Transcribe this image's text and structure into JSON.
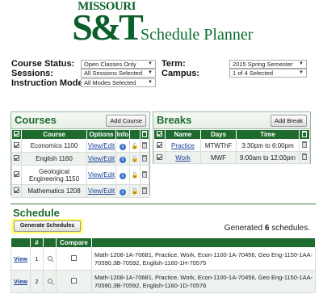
{
  "header": {
    "logo_top": "MISSOURI",
    "logo_main": "S&T",
    "title": "Schedule Planner"
  },
  "filters": {
    "course_status": {
      "label": "Course Status:",
      "value": "Open Classes Only"
    },
    "sessions": {
      "label": "Sessions:",
      "value": "All Sessions Selected"
    },
    "instruction_mode": {
      "label": "Instruction Mode:",
      "value": "All Modes Selected"
    },
    "term": {
      "label": "Term:",
      "value": "2015 Spring Semester"
    },
    "campus": {
      "label": "Campus:",
      "value": "1 of 4 Selected"
    }
  },
  "courses": {
    "title": "Courses",
    "add_button": "Add Course",
    "headers": [
      "Course",
      "Options",
      "Info"
    ],
    "rows": [
      {
        "course": "Economics 1100",
        "option": "View/Edit"
      },
      {
        "course": "English 1160",
        "option": "View/Edit"
      },
      {
        "course": "Geological Engineering 1150",
        "option": "View/Edit"
      },
      {
        "course": "Mathematics 1208",
        "option": "View/Edit"
      }
    ]
  },
  "breaks": {
    "title": "Breaks",
    "add_button": "Add Break",
    "headers": [
      "Name",
      "Days",
      "Time"
    ],
    "rows": [
      {
        "name": "Practice",
        "days": "MTWThF",
        "time": "3:30pm to 6:00pm"
      },
      {
        "name": "Work",
        "days": "MWF",
        "time": "9:00am to 12:00pm"
      }
    ]
  },
  "schedule": {
    "title": "Schedule",
    "generate_button": "Generate Schedules",
    "generated_prefix": "Generated",
    "generated_count": "6",
    "generated_suffix": "schedules.",
    "headers": [
      "#",
      "Compare"
    ],
    "rows": [
      {
        "view": "View",
        "num": "1",
        "desc": "Math-1208-1A-70681, Practice, Work, Econ-1100-1A-70456, Geo Eng-1150-1AA-70590,3B-70592, English-1160-1H-70575"
      },
      {
        "view": "View",
        "num": "2",
        "desc": "Math-1208-1A-70681, Practice, Work, Econ-1100-1A-70456, Geo Eng-1150-1AA-70590,3B-70592, English-1160-1D-70576"
      }
    ]
  }
}
